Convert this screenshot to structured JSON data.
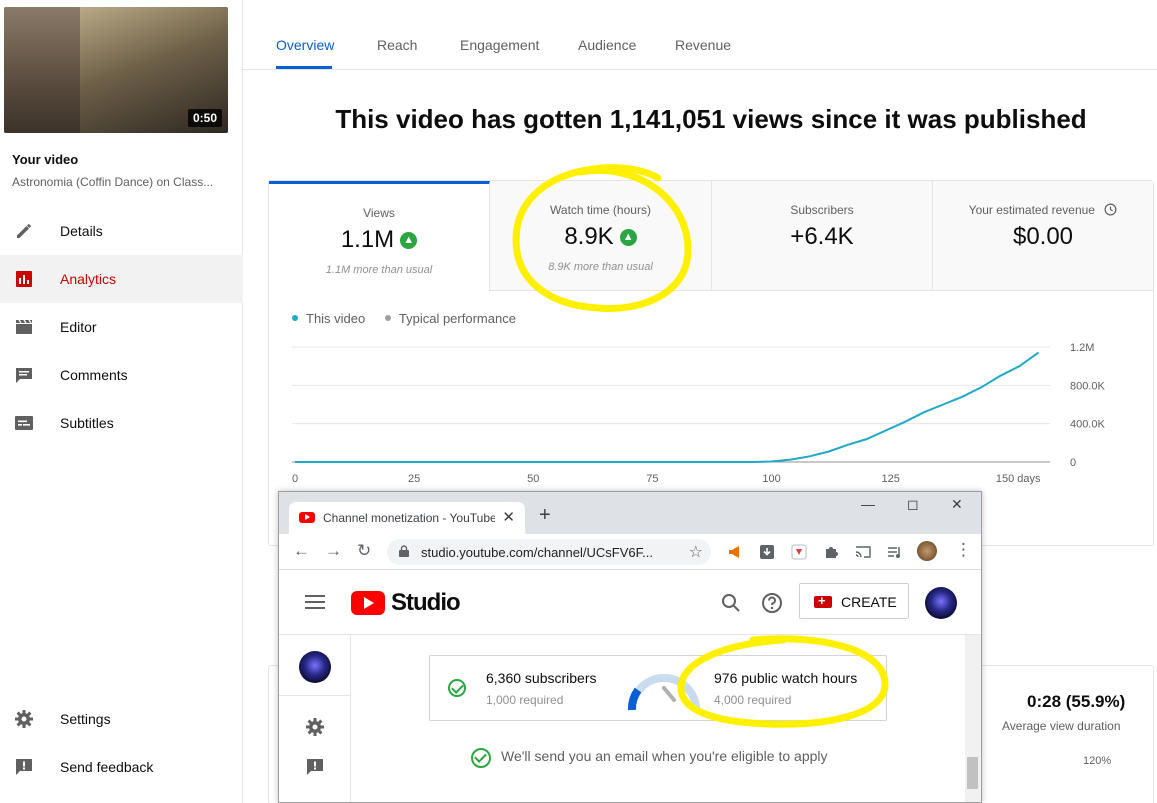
{
  "sidebar": {
    "duration": "0:50",
    "your_video_label": "Your video",
    "video_title": "Astronomia (Coffin Dance) on Class...",
    "items": [
      {
        "label": "Details",
        "icon": "pencil-icon"
      },
      {
        "label": "Analytics",
        "icon": "analytics-icon"
      },
      {
        "label": "Editor",
        "icon": "clapperboard-icon"
      },
      {
        "label": "Comments",
        "icon": "comment-icon"
      },
      {
        "label": "Subtitles",
        "icon": "subtitles-icon"
      }
    ],
    "bottom_items": [
      {
        "label": "Settings",
        "icon": "gear-icon"
      },
      {
        "label": "Send feedback",
        "icon": "feedback-icon"
      }
    ]
  },
  "tabs": [
    "Overview",
    "Reach",
    "Engagement",
    "Audience",
    "Revenue"
  ],
  "active_tab": "Overview",
  "headline": "This video has gotten 1,141,051 views since it was published",
  "metrics": [
    {
      "label": "Views",
      "value": "1.1M",
      "sub": "1.1M more than usual",
      "trend": "up"
    },
    {
      "label": "Watch time (hours)",
      "value": "8.9K",
      "sub": "8.9K more than usual",
      "trend": "up"
    },
    {
      "label": "Subscribers",
      "value": "+6.4K",
      "sub": "",
      "trend": ""
    },
    {
      "label": "Your estimated revenue",
      "value": "$0.00",
      "sub": "",
      "trend": ""
    }
  ],
  "legend": {
    "this_video": "This video",
    "typical": "Typical performance"
  },
  "colors": {
    "accent": "#065fd4",
    "series": "#20a8c7",
    "typical": "#a0a0a0",
    "active_nav": "#cc0000",
    "up": "#2ba640",
    "highlight": "#fff000"
  },
  "chart_data": {
    "type": "line",
    "x_ticks": [
      "0",
      "25",
      "50",
      "75",
      "100",
      "125",
      "150 days"
    ],
    "y_ticks": [
      "0",
      "400.0K",
      "800.0K",
      "1.2M"
    ],
    "ylim": [
      0,
      1200000
    ],
    "xlim": [
      0,
      158
    ],
    "series": [
      {
        "name": "This video",
        "x": [
          0,
          50,
          96,
          100,
          104,
          108,
          112,
          116,
          120,
          124,
          128,
          132,
          136,
          140,
          144,
          148,
          152,
          156
        ],
        "y": [
          0,
          0,
          0,
          5000,
          25000,
          60000,
          110000,
          180000,
          240000,
          330000,
          420000,
          520000,
          600000,
          680000,
          780000,
          900000,
          1000000,
          1141051
        ]
      }
    ]
  },
  "lower_card": {
    "avg_duration": "0:28 (55.9%)",
    "avg_label": "Average view duration",
    "pct": "120%"
  },
  "browser": {
    "tab_title": "Channel monetization - YouTube",
    "url": "studio.youtube.com/channel/UCsFV6F...",
    "studio_word": "Studio",
    "create_label": "CREATE",
    "subs_main": "6,360 subscribers",
    "subs_req": "1,000 required",
    "hours_main": "976 public watch hours",
    "hours_req": "4,000 required",
    "email_note": "We'll send you an email when you're eligible to apply"
  }
}
